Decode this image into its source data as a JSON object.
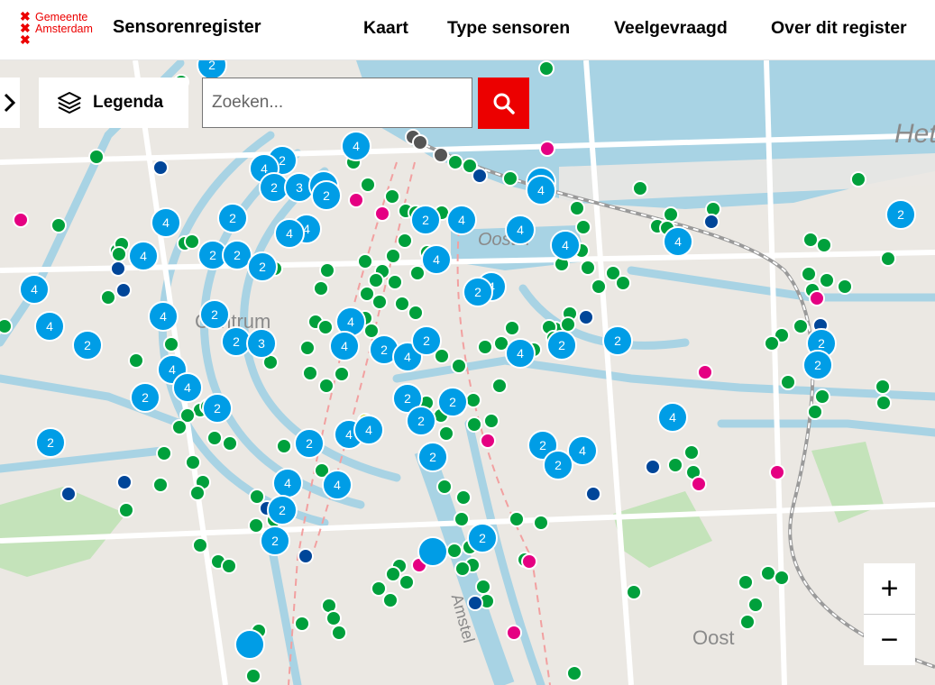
{
  "header": {
    "logo_line1": "Gemeente",
    "logo_line2": "Amsterdam",
    "app_title": "Sensorenregister",
    "nav": [
      {
        "label": "Kaart"
      },
      {
        "label": "Type sensoren"
      },
      {
        "label": "Veelgevraagd"
      },
      {
        "label": "Over dit register"
      }
    ]
  },
  "controls": {
    "legend_label": "Legenda",
    "search_placeholder": "Zoeken...",
    "zoom_in": "+",
    "zoom_out": "−"
  },
  "map": {
    "labels": [
      "Centrum",
      "Oost",
      "Oostel",
      "Het",
      "Amstel"
    ]
  },
  "colors": {
    "brand_red": "#ec0000",
    "cluster_blue": "#009de6",
    "sensor_green": "#00a03c",
    "sensor_navy": "#004699",
    "sensor_pink": "#e50082",
    "sensor_dark": "#555555",
    "sensor_lime": "#bed200",
    "water": "#a8d3e4",
    "park": "#c4e3ba"
  },
  "icons": {
    "logo": "amsterdam-xxx-logo",
    "toggle": "chevron-right-icon",
    "legend": "layers-icon",
    "search": "search-icon"
  },
  "clusters": [
    "2",
    "4",
    "2",
    "4",
    "2",
    "3",
    "4",
    "2",
    "4",
    "2",
    "4",
    "4",
    "2",
    "2",
    "4",
    "2",
    "4",
    "2",
    "4",
    "4",
    "4",
    "4",
    "2",
    "4",
    "4",
    "2",
    "2",
    "4",
    "4",
    "2",
    "4",
    "4",
    "2",
    "2",
    "3",
    "4",
    "2",
    "4",
    "2",
    "4",
    "2",
    "2",
    "2",
    "2",
    "4",
    "4",
    "2",
    "2",
    "2",
    "2",
    "2",
    "4",
    "4",
    "2",
    "4",
    "2",
    "4",
    "2",
    "2",
    "2",
    "4",
    "4",
    "2",
    "2",
    "2"
  ]
}
